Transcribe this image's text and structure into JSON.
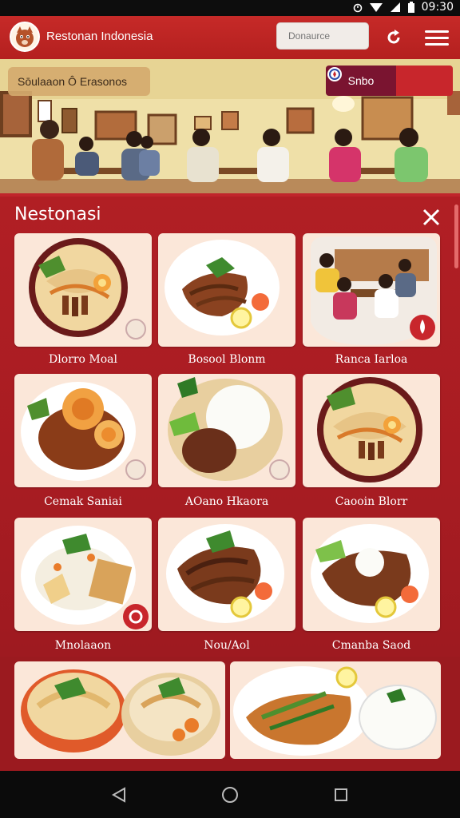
{
  "status_bar": {
    "time": "09:30"
  },
  "app_bar": {
    "title": "Restonan Indonesia",
    "search_placeholder": "Donaurce",
    "refresh_icon": "refresh-icon",
    "menu_icon": "menu-icon"
  },
  "hero": {
    "chip_label": "Sōulaaon Ô Erasonos",
    "toggle_label": "Snbo"
  },
  "panel": {
    "title": "Nestonasi",
    "close_icon": "close-icon"
  },
  "menu_items": [
    {
      "label": "Dlorro Moal"
    },
    {
      "label": "Bosool Blonm"
    },
    {
      "label": "Ranca Iarloa"
    },
    {
      "label": "Cemak Saniai"
    },
    {
      "label": "AOano Hkaora"
    },
    {
      "label": "Caooin Blorr"
    },
    {
      "label": "Mnolaaon"
    },
    {
      "label": "Nou/Aol"
    },
    {
      "label": "Cmanba Saod"
    }
  ],
  "colors": {
    "brand_red": "#b4201f",
    "card_bg": "#fbe7d9",
    "toggle_purple": "#7a1430"
  }
}
